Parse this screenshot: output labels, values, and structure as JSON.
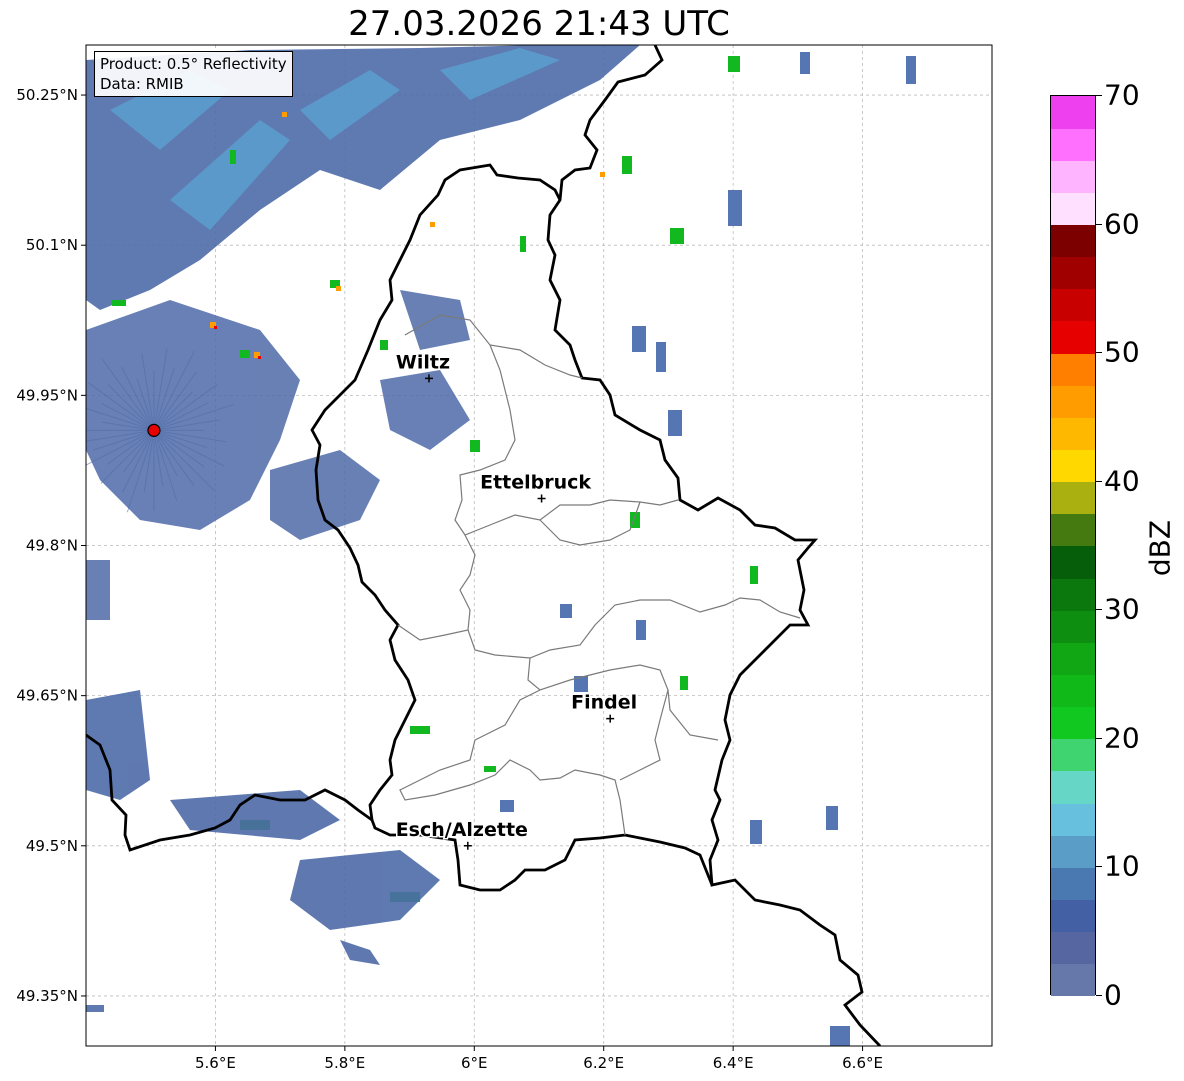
{
  "title": "27.03.2026 21:43 UTC",
  "info": {
    "product": "Product: 0.5° Reflectivity",
    "data": "Data: RMIB"
  },
  "map": {
    "lon_range": [
      5.4,
      6.8
    ],
    "lat_range": [
      49.3,
      50.3
    ],
    "x_ticks": [
      {
        "value": 5.6,
        "label": "5.6°E"
      },
      {
        "value": 5.8,
        "label": "5.8°E"
      },
      {
        "value": 6.0,
        "label": "6°E"
      },
      {
        "value": 6.2,
        "label": "6.2°E"
      },
      {
        "value": 6.4,
        "label": "6.4°E"
      },
      {
        "value": 6.6,
        "label": "6.6°E"
      }
    ],
    "y_ticks": [
      {
        "value": 50.25,
        "label": "50.25°N"
      },
      {
        "value": 50.1,
        "label": "50.1°N"
      },
      {
        "value": 49.95,
        "label": "49.95°N"
      },
      {
        "value": 49.8,
        "label": "49.8°N"
      },
      {
        "value": 49.65,
        "label": "49.65°N"
      },
      {
        "value": 49.5,
        "label": "49.5°N"
      },
      {
        "value": 49.35,
        "label": "49.35°N"
      }
    ],
    "gridlines": true,
    "radar_site": {
      "lon": 5.505,
      "lat": 49.915
    },
    "cities": [
      {
        "name": "Wiltz",
        "lon": 5.93,
        "lat": 49.967
      },
      {
        "name": "Ettelbruck",
        "lon": 6.104,
        "lat": 49.847
      },
      {
        "name": "Findel",
        "lon": 6.21,
        "lat": 49.627
      },
      {
        "name": "Esch/Alzette",
        "lon": 5.99,
        "lat": 49.5
      }
    ]
  },
  "colorbar": {
    "label": "dBZ",
    "ticks": [
      "0",
      "10",
      "20",
      "30",
      "40",
      "50",
      "60",
      "70"
    ],
    "colors": [
      "#6677aa",
      "#5566a0",
      "#4460a5",
      "#4a78b0",
      "#5a9ec8",
      "#66c0de",
      "#66d6c6",
      "#40d470",
      "#10c820",
      "#10b818",
      "#10a614",
      "#0e8e10",
      "#0a780c",
      "#075e0a",
      "#457a10",
      "#aab010",
      "#ffd800",
      "#ffb800",
      "#ff9c00",
      "#ff8000",
      "#e60000",
      "#c80000",
      "#a00000",
      "#7c0000",
      "#ffe0ff",
      "#ffb4ff",
      "#ff70ff",
      "#ee40ee"
    ]
  }
}
